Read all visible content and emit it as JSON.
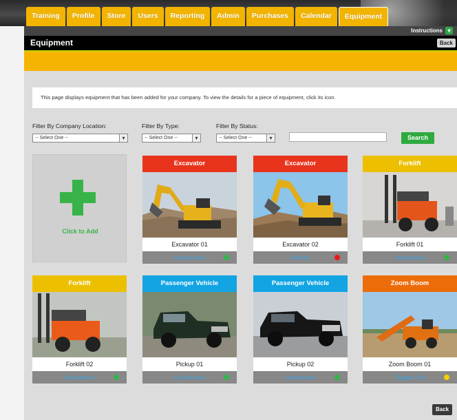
{
  "nav": {
    "tabs": [
      {
        "label": "Training"
      },
      {
        "label": "Profile"
      },
      {
        "label": "Store"
      },
      {
        "label": "Users"
      },
      {
        "label": "Reporting"
      },
      {
        "label": "Admin"
      },
      {
        "label": "Purchases"
      },
      {
        "label": "Calendar"
      },
      {
        "label": "Equipment"
      }
    ],
    "active_tab": "Equipment",
    "instructions_label": "Instructions"
  },
  "header": {
    "title": "Equipment",
    "back_label": "Back"
  },
  "description": "This page displays equipment that has been added for your company. To view the details for a piece of equipment, click its icon.",
  "filters": {
    "location": {
      "label": "Filter By Company Location:",
      "value": "-- Select One --"
    },
    "type": {
      "label": "Filter By Type:",
      "value": "-- Select One --"
    },
    "status": {
      "label": "Filter By Status:",
      "value": "-- Select One --"
    },
    "search_value": "",
    "search_label": "Search"
  },
  "add_tile": {
    "label": "Click to Add"
  },
  "cards": [
    {
      "type": "Excavator",
      "name": "Excavator 01",
      "status": "Operational",
      "type_color": "#e8341c",
      "status_color": "#33b54a"
    },
    {
      "type": "Excavator",
      "name": "Excavator 02",
      "status": "Retired",
      "type_color": "#e8341c",
      "status_color": "#e51b1b"
    },
    {
      "type": "Forklift",
      "name": "Forklift 01",
      "status": "Operational",
      "type_color": "#ecc000",
      "status_color": "#33b54a"
    },
    {
      "type": "Forklift",
      "name": "Forklift 02",
      "status": "Operational",
      "type_color": "#ecc000",
      "status_color": "#33b54a"
    },
    {
      "type": "Passenger Vehicle",
      "name": "Pickup 01",
      "status": "Operational",
      "type_color": "#12a4e3",
      "status_color": "#33b54a"
    },
    {
      "type": "Passenger Vehicle",
      "name": "Pickup 02",
      "status": "Operational",
      "type_color": "#12a4e3",
      "status_color": "#33b54a"
    },
    {
      "type": "Zoom Boom",
      "name": "Zoom Boom 01",
      "status": "Tagged Out",
      "type_color": "#ec6c0a",
      "status_color": "#f2d000"
    }
  ],
  "footer": {
    "back_label": "Back"
  }
}
